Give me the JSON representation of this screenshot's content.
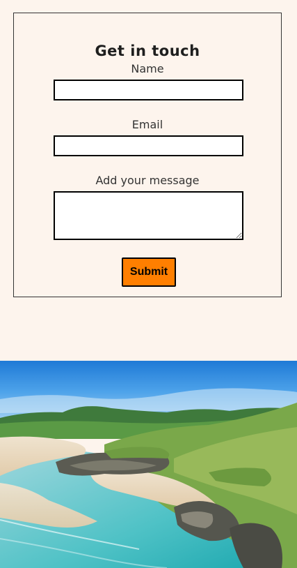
{
  "form": {
    "title": "Get in touch",
    "name_label": "Name",
    "name_value": "",
    "email_label": "Email",
    "email_value": "",
    "message_label": "Add your message",
    "message_value": "",
    "submit_label": "Submit",
    "submit_color": "#ff7f00"
  },
  "page": {
    "background_color": "#fdf4ed"
  },
  "hero_image": {
    "subject": "coastal-beach-landscape-photo"
  }
}
